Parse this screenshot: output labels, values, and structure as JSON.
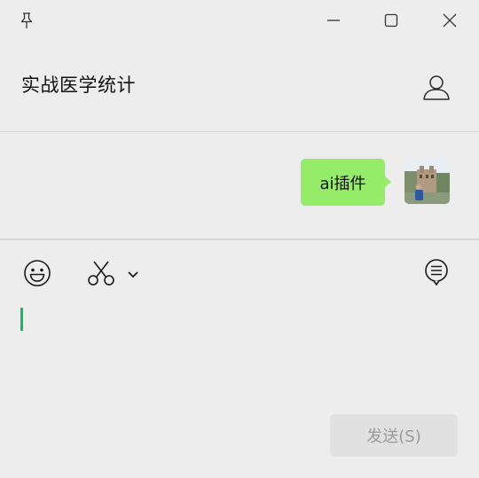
{
  "titlebar": {
    "icons": [
      "pin-icon",
      "minimize-icon",
      "maximize-icon",
      "close-icon"
    ]
  },
  "chat": {
    "title": "实战医学统计"
  },
  "messages": [
    {
      "from": "self",
      "text": "ai插件",
      "bubble_color": "#95ec69"
    }
  ],
  "toolbar": {
    "icons": [
      "emoji-icon",
      "scissors-icon",
      "chevron-down-icon",
      "chat-history-icon"
    ]
  },
  "composer": {
    "send_label": "发送(S)",
    "cursor_color": "#07c160"
  }
}
